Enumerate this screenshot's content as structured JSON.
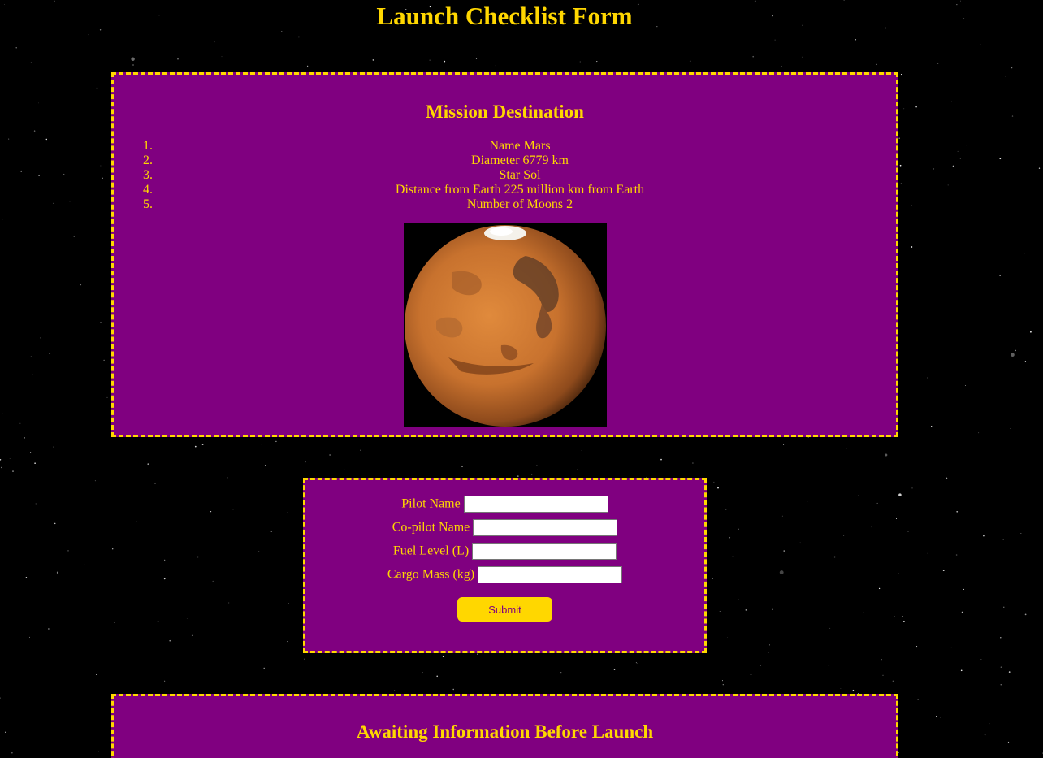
{
  "page": {
    "title": "Launch Checklist Form"
  },
  "mission": {
    "heading": "Mission Destination",
    "items": [
      {
        "num": "1.",
        "text": "Name Mars"
      },
      {
        "num": "2.",
        "text": "Diameter 6779 km"
      },
      {
        "num": "3.",
        "text": "Star Sol"
      },
      {
        "num": "4.",
        "text": "Distance from Earth 225 million km from Earth"
      },
      {
        "num": "5.",
        "text": "Number of Moons 2"
      }
    ],
    "image": "mars-planet"
  },
  "form": {
    "pilot_label": "Pilot Name",
    "pilot_value": "",
    "copilot_label": "Co-pilot Name",
    "copilot_value": "",
    "fuel_label": "Fuel Level (L)",
    "fuel_value": "",
    "cargo_label": "Cargo Mass (kg)",
    "cargo_value": "",
    "submit_label": "Submit"
  },
  "status": {
    "heading": "Awaiting Information Before Launch"
  },
  "colors": {
    "background": "#000000",
    "panel": "#800080",
    "accent": "#ffd700"
  }
}
